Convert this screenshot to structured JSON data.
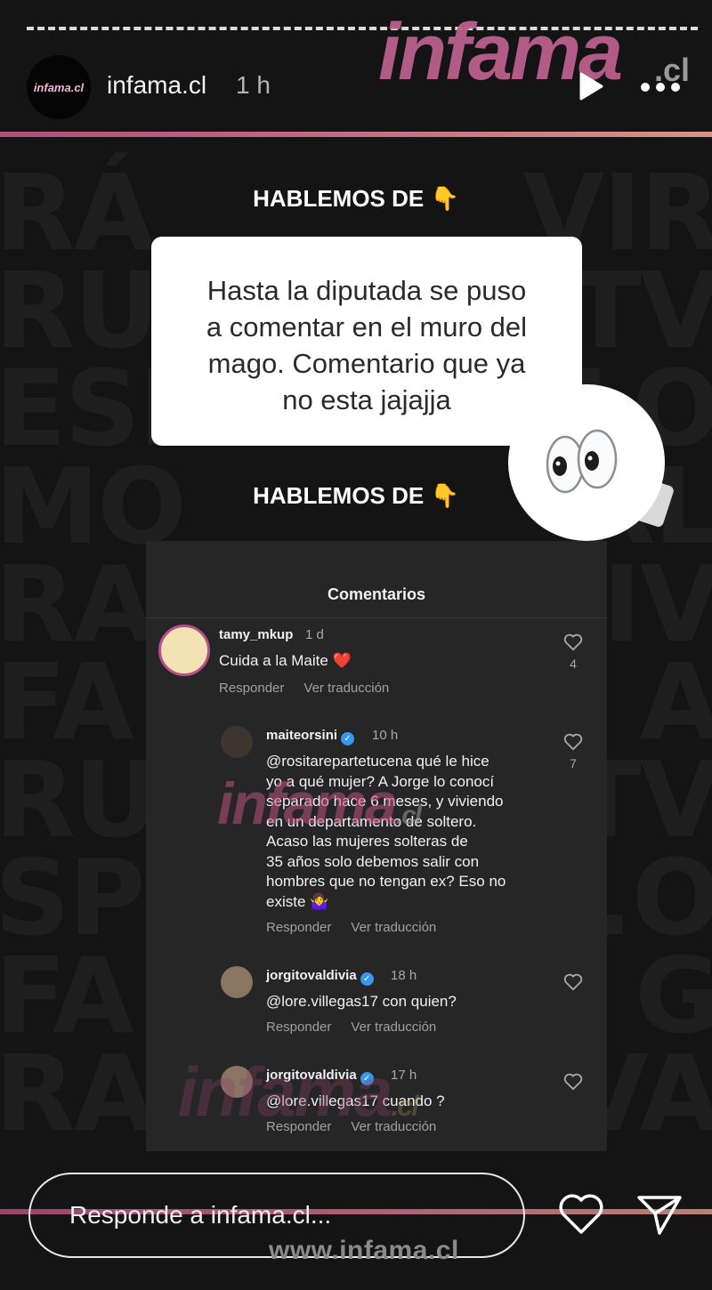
{
  "story": {
    "account_handle": "infama.cl",
    "time_ago": "1 h",
    "avatar_text": "infama.cl",
    "brand_logo": "infama",
    "brand_logo_suffix": ".cl",
    "progress_segments": 1
  },
  "headings": {
    "top": "HABLEMOS DE",
    "bottom": "HABLEMOS DE",
    "emoji": "👇"
  },
  "question_bubble": {
    "lines": [
      "Hasta la diputada se puso",
      "a comentar en el muro del",
      "mago. Comentario que ya",
      "no esta jajajja"
    ]
  },
  "sticker": {
    "icon": "eyes-emoji"
  },
  "comments_panel": {
    "title": "Comentarios",
    "comments": [
      {
        "user": "tamy_mkup",
        "verified": false,
        "time": "1 d",
        "text": "Cuida a la Maite ❤️",
        "reply_label": "Responder",
        "translate_label": "Ver traducción",
        "likes": "4"
      },
      {
        "user": "maiteorsini",
        "verified": true,
        "time": "10 h",
        "lines": [
          "@rositarepartetucena qué le hice",
          "yo a qué mujer? A Jorge lo conocí",
          "separado hace 6 meses, y viviendo",
          "en un departamento de soltero.",
          "Acaso las mujeres solteras de",
          "35 años solo debemos salir con",
          "hombres que no tengan ex? Eso no",
          "existe 🤷‍♀️"
        ],
        "reply_label": "Responder",
        "translate_label": "Ver traducción",
        "likes": "7"
      },
      {
        "user": "jorgitovaldivia",
        "verified": true,
        "time": "18 h",
        "text": "@lore.villegas17 con quien?",
        "reply_label": "Responder",
        "translate_label": "Ver traducción"
      },
      {
        "user": "jorgitovaldivia",
        "verified": true,
        "time": "17 h",
        "text": "@lore.villegas17 cuando ?",
        "reply_label": "Responder",
        "translate_label": "Ver traducción"
      }
    ],
    "watermark": "infama",
    "watermark_suffix": ".cl"
  },
  "footer": {
    "reply_placeholder": "Responde a infama.cl...",
    "website": "www.infama.cl"
  },
  "colors": {
    "accent_stripe": "#c46c86",
    "background": "#141414",
    "panel": "#262626",
    "verified": "#3897f0"
  }
}
